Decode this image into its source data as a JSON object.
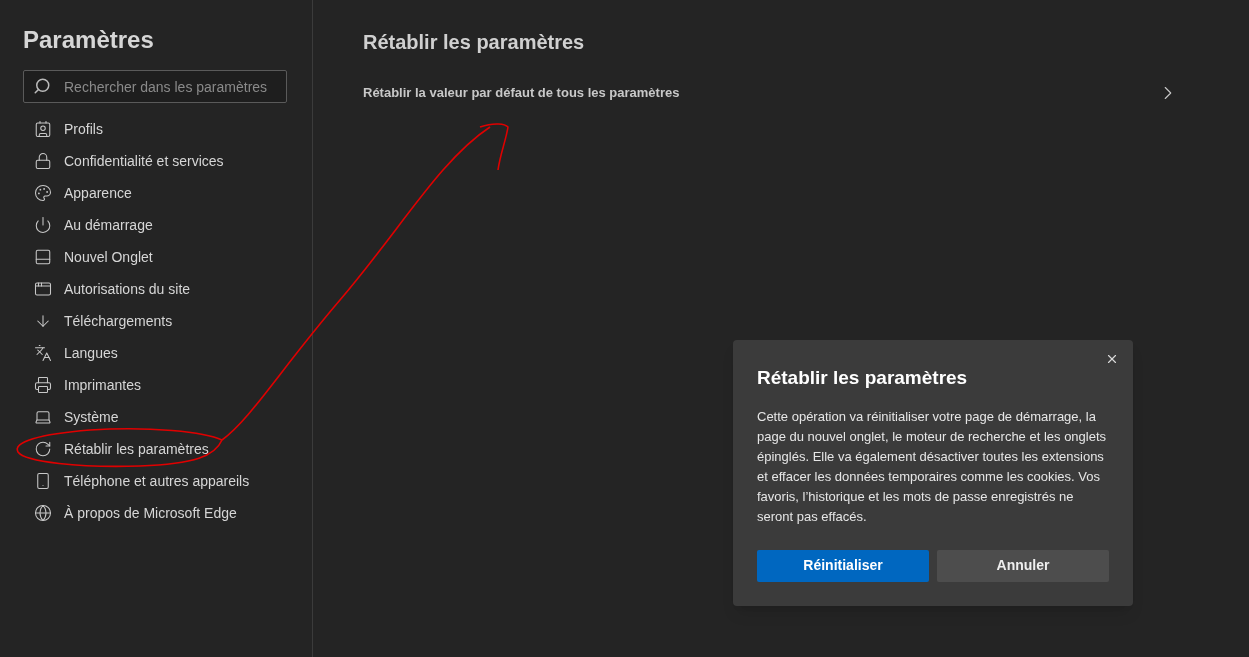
{
  "sidebar": {
    "title": "Paramètres",
    "search": {
      "placeholder": "Rechercher dans les paramètres"
    },
    "items": [
      {
        "label": "Profils",
        "kind": "profile"
      },
      {
        "label": "Confidentialité et services",
        "kind": "lock"
      },
      {
        "label": "Apparence",
        "kind": "palette"
      },
      {
        "label": "Au démarrage",
        "kind": "power"
      },
      {
        "label": "Nouvel Onglet",
        "kind": "newtab"
      },
      {
        "label": "Autorisations du site",
        "kind": "site"
      },
      {
        "label": "Téléchargements",
        "kind": "download"
      },
      {
        "label": "Langues",
        "kind": "language"
      },
      {
        "label": "Imprimantes",
        "kind": "printer"
      },
      {
        "label": "Système",
        "kind": "laptop"
      },
      {
        "label": "Rétablir les paramètres",
        "kind": "reset"
      },
      {
        "label": "Téléphone et autres appareils",
        "kind": "phone"
      },
      {
        "label": "À propos de Microsoft Edge",
        "kind": "edge"
      }
    ]
  },
  "main": {
    "title": "Rétablir les paramètres",
    "row": {
      "label": "Rétablir la valeur par défaut de tous les paramètres"
    }
  },
  "dialog": {
    "title": "Rétablir les paramètres",
    "body": "Cette opération va réinitialiser votre page de démarrage, la page du nouvel onglet, le moteur de recherche et les onglets épinglés. Elle va également désactiver toutes les extensions et effacer les données temporaires comme les cookies. Vos favoris, l’historique et les mots de passe enregistrés ne seront pas effacés.",
    "buttons": [
      {
        "label": "Réinitialiser",
        "kind": "primary"
      },
      {
        "label": "Annuler",
        "kind": "secondary"
      }
    ]
  }
}
